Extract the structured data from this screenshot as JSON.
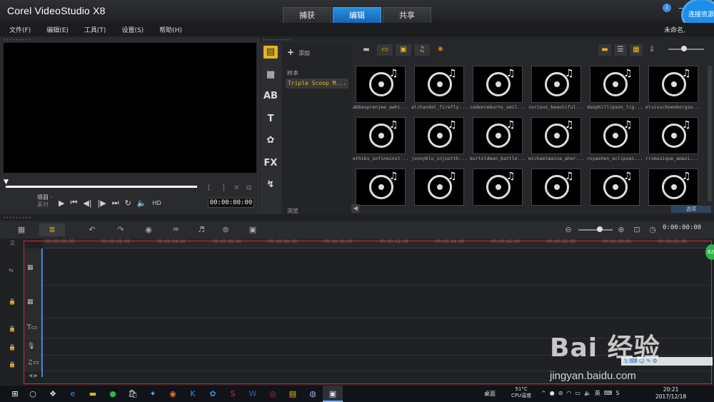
{
  "app": {
    "title": "Corel VideoStudio X8",
    "tabs": [
      "捕获",
      "编辑",
      "共享"
    ],
    "connect_label": "连接资源",
    "info_icon": "i",
    "minimize": "—"
  },
  "menu": {
    "items": [
      "文件(F)",
      "编辑(E)",
      "工具(T)",
      "设置(S)",
      "帮助(H)"
    ],
    "project_name": "未命名, "
  },
  "player": {
    "mode_project": "项目 ·",
    "mode_clip": "素材",
    "hd_label": "HD",
    "timecode": "00:00:00:00",
    "brackets": [
      "[",
      "]"
    ]
  },
  "library": {
    "add_label": "添加",
    "sample_label": "样本",
    "folder_selected": "Triple Scoop M...",
    "browse_label": "浏览",
    "advanced_label": "选项",
    "items": [
      "abbasprenjee_awhi...",
      "alihandal_firefly...",
      "cadenceburns_smil...",
      "curious_beautiful...",
      "danphillipson_lig...",
      "elvisschoenbergso...",
      "ethiks_sofineinst...",
      "jonnyblu_injustth...",
      "kurtoldman_battle...",
      "michaelmaina_aher...",
      "royashen_eclipsei...",
      "rrsmusique_amazi...",
      "",
      "",
      "",
      "",
      "",
      ""
    ]
  },
  "timeline": {
    "timecode": "0:00:00:00",
    "ruler_ticks": [
      "00:00:00:00",
      "00:00:02:00",
      "00:00:04:00",
      "00:00:06:00",
      "00:00:08:00",
      "00:00:10:00",
      "00:00:12:00",
      "00:00:14:00",
      "00:00:16:00",
      "00:00:18:00",
      "00:00:20:00",
      "00:00:22:00"
    ],
    "badge": "62"
  },
  "watermark": {
    "main": "Bai 经验",
    "url": "jingyan.baidu.com"
  },
  "taskbar": {
    "desktop_label": "桌面",
    "temp_value": "51°C",
    "temp_label": "CPU温度",
    "ime": "英",
    "time": "20:21",
    "date": "2017/12/18"
  },
  "colors": {
    "accent": "#1e8ee8",
    "highlight": "#e6b422",
    "frame": "#e0262e"
  }
}
